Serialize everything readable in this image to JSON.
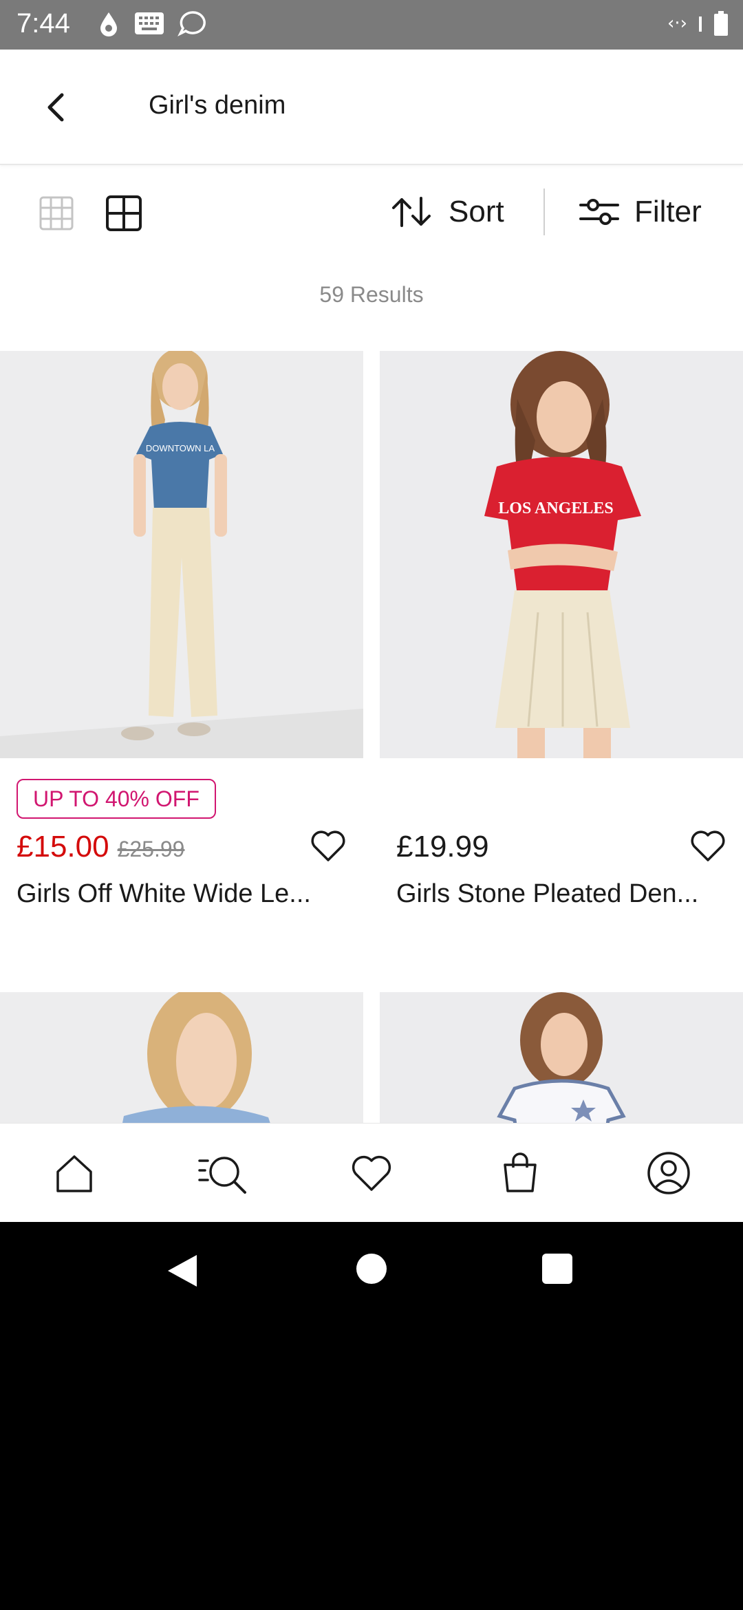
{
  "status_bar": {
    "time": "7:44",
    "left_icons": [
      "drop-icon",
      "keyboard-icon",
      "chat-bubble-icon"
    ],
    "right_icons": [
      "wifi-calling-icon",
      "battery-icon"
    ]
  },
  "header": {
    "title": "Girl's denim"
  },
  "toolbar": {
    "sort_label": "Sort",
    "filter_label": "Filter"
  },
  "results": {
    "count_label": "59 Results"
  },
  "products": [
    {
      "badge": "UP TO 40% OFF",
      "price": "£15.00",
      "was_price": "£25.99",
      "name": "Girls Off White Wide Le...",
      "image_desc": "girl in blue t-shirt and off white wide leg jeans"
    },
    {
      "badge": "",
      "price": "£19.99",
      "was_price": "",
      "name": "Girls Stone Pleated Den...",
      "image_desc": "girl in red t-shirt and stone pleated denim skirt"
    }
  ],
  "bottom_nav": {
    "items": [
      "home-icon",
      "search-icon",
      "heart-icon",
      "bag-icon",
      "account-icon"
    ]
  },
  "colors": {
    "accent_pink": "#d11670",
    "sale_red": "#d40b0b",
    "status_bar": "#7a7a7a"
  }
}
